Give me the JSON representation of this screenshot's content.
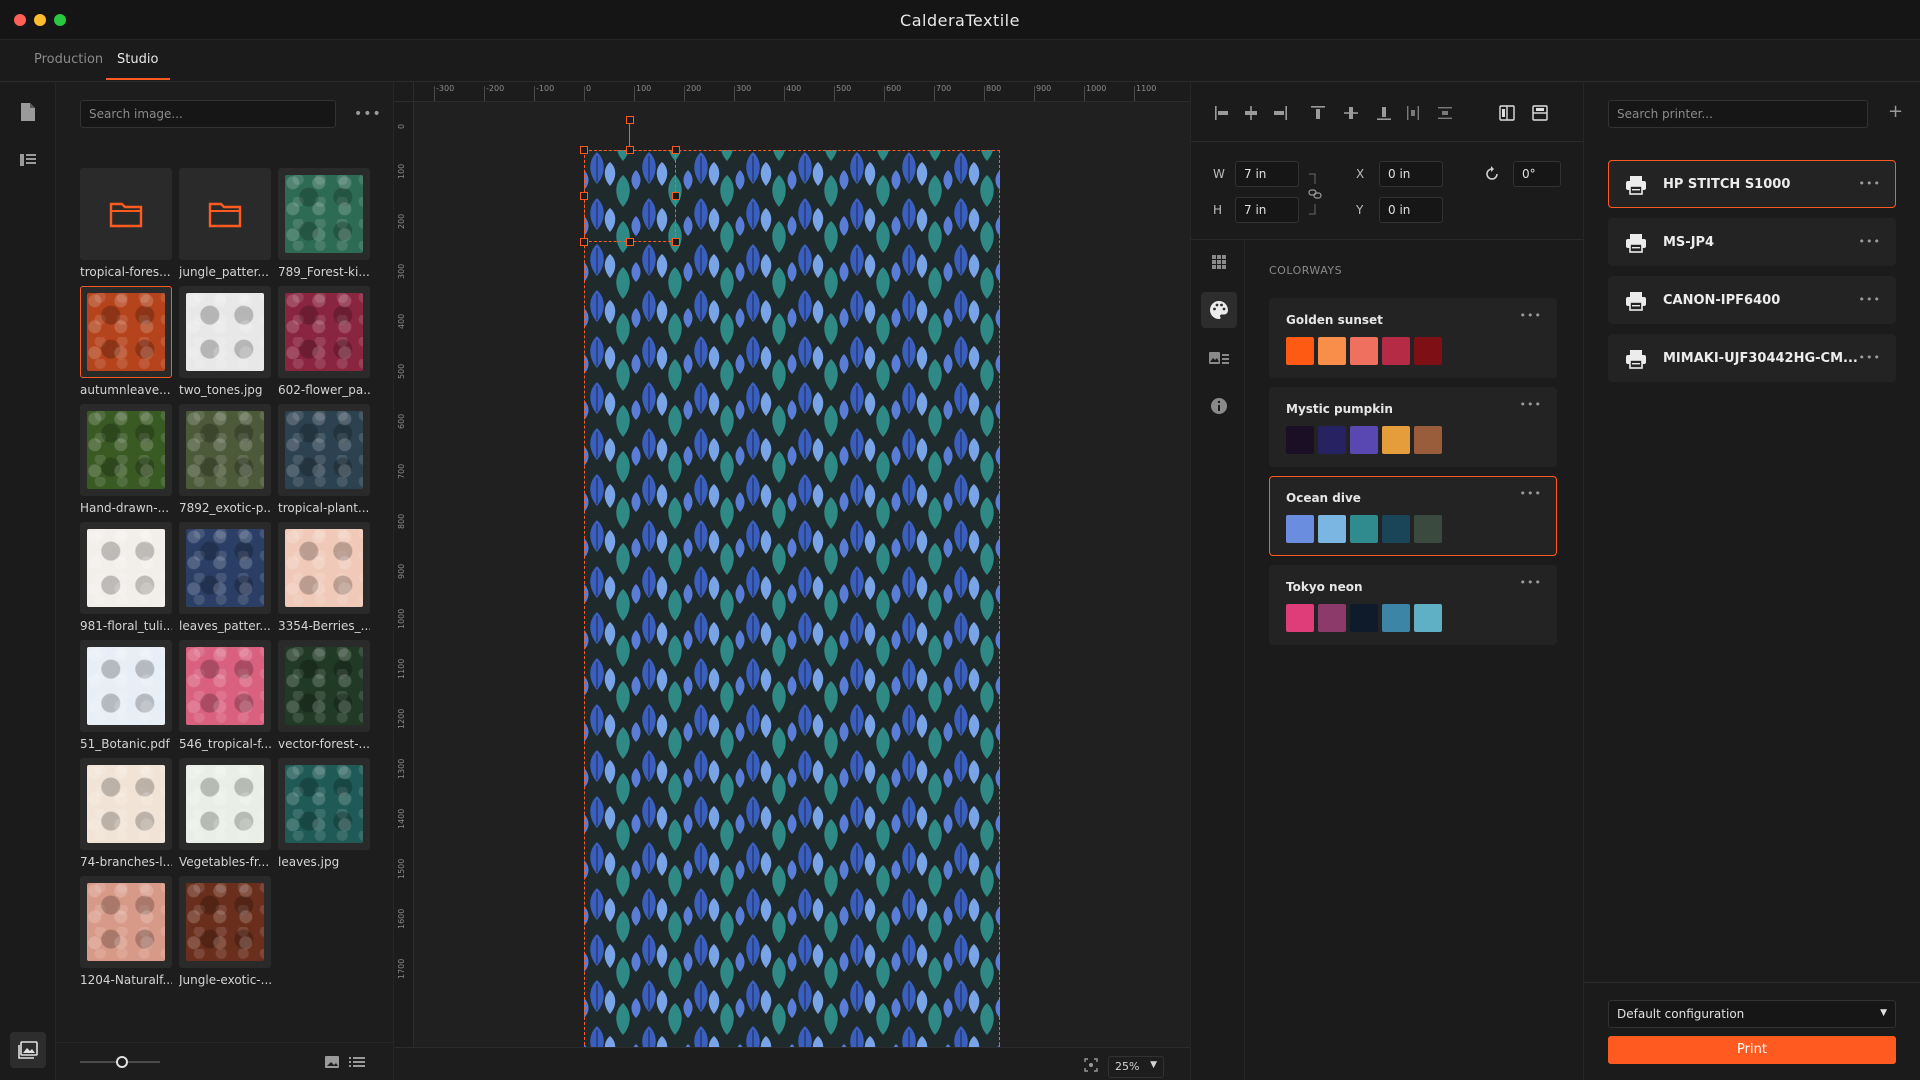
{
  "app": {
    "title": "CalderaTextile"
  },
  "tabs": [
    {
      "label": "Production"
    },
    {
      "label": "Studio"
    }
  ],
  "gallery": {
    "search_placeholder": "Search image...",
    "items": [
      {
        "name": "tropical-fores...",
        "kind": "folder"
      },
      {
        "name": "jungle_patter...",
        "kind": "folder"
      },
      {
        "name": "789_Forest-ki...",
        "kind": "image",
        "color": "#2e6b55"
      },
      {
        "name": "autumnleave...",
        "kind": "image",
        "color": "#b5431c"
      },
      {
        "name": "two_tones.jpg",
        "kind": "image",
        "color": "#e8e8e8"
      },
      {
        "name": "602-flower_pa...",
        "kind": "image",
        "color": "#8a2540"
      },
      {
        "name": "Hand-drawn-...",
        "kind": "image",
        "color": "#3a5a24"
      },
      {
        "name": "7892_exotic-p...",
        "kind": "image",
        "color": "#4c5a3a"
      },
      {
        "name": "tropical-plant...",
        "kind": "image",
        "color": "#2d4250"
      },
      {
        "name": "981-floral_tuli...",
        "kind": "image",
        "color": "#f2eeea"
      },
      {
        "name": "leaves_patter...",
        "kind": "image",
        "color": "#2b3f66"
      },
      {
        "name": "3354-Berries_...",
        "kind": "image",
        "color": "#f0c9b8"
      },
      {
        "name": "51_Botanic.pdf",
        "kind": "image",
        "color": "#e7eef5"
      },
      {
        "name": "546_tropical-f...",
        "kind": "image",
        "color": "#d9607e"
      },
      {
        "name": "vector-forest-...",
        "kind": "image",
        "color": "#213a25"
      },
      {
        "name": "74-branches-l...",
        "kind": "image",
        "color": "#f1e3d6"
      },
      {
        "name": "Vegetables-fr...",
        "kind": "image",
        "color": "#e9efe6"
      },
      {
        "name": "leaves.jpg",
        "kind": "image",
        "color": "#1f5a56"
      },
      {
        "name": "1204-Naturalf...",
        "kind": "image",
        "color": "#d89a88"
      },
      {
        "name": "Jungle-exotic-...",
        "kind": "image",
        "color": "#6a2e1c"
      }
    ]
  },
  "ruler": {
    "h_labels": [
      "-300",
      "-200",
      "-100",
      "0",
      "100",
      "200",
      "300",
      "400",
      "500",
      "600",
      "700",
      "800",
      "900",
      "1000",
      "1100"
    ],
    "v_labels": [
      "0",
      "100",
      "200",
      "300",
      "400",
      "500",
      "600",
      "700",
      "800",
      "900",
      "1000",
      "1100",
      "1200",
      "1300",
      "1400",
      "1500",
      "1600",
      "1700"
    ]
  },
  "zoom": "25%",
  "transform": {
    "w_label": "W",
    "w_value": "7 in",
    "h_label": "H",
    "h_value": "7 in",
    "x_label": "X",
    "x_value": "0 in",
    "y_label": "Y",
    "y_value": "0 in",
    "rotation": "0°"
  },
  "colorways": {
    "heading": "COLORWAYS",
    "items": [
      {
        "name": "Golden sunset",
        "swatches": [
          "#ff5a14",
          "#f98e4a",
          "#f07060",
          "#b52a45",
          "#7e0f15"
        ]
      },
      {
        "name": "Mystic pumpkin",
        "swatches": [
          "#1a0f24",
          "#272363",
          "#5a48b2",
          "#e59d3c",
          "#9a5d3c"
        ]
      },
      {
        "name": "Ocean dive",
        "swatches": [
          "#6a8de0",
          "#7bb6e2",
          "#2f8b8e",
          "#1a4458",
          "#3b4a3f"
        ]
      },
      {
        "name": "Tokyo neon",
        "swatches": [
          "#de3d7a",
          "#8c3a6a",
          "#0f1a2b",
          "#3d85a6",
          "#5fb0c4"
        ]
      }
    ]
  },
  "printers": {
    "search_placeholder": "Search printer...",
    "items": [
      {
        "name": "HP STITCH S1000"
      },
      {
        "name": "MS-JP4"
      },
      {
        "name": "CANON-IPF6400"
      },
      {
        "name": "MIMAKI-UJF30442HG-CM..."
      }
    ],
    "config": "Default configuration",
    "print_label": "Print"
  }
}
